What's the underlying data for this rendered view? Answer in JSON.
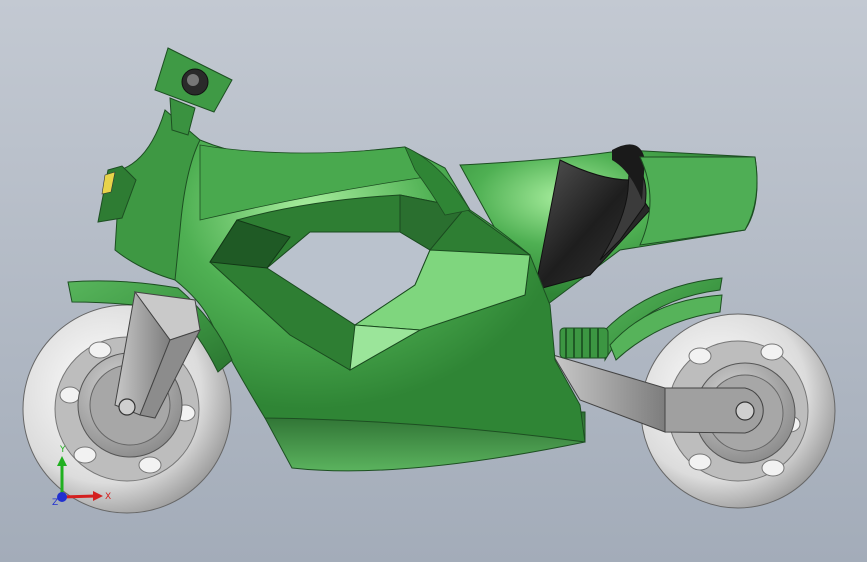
{
  "window": {
    "title": ""
  },
  "model": {
    "name": "",
    "parts": [
      {
        "id": "front-wheel",
        "icon": "wheel"
      },
      {
        "id": "rear-wheel",
        "icon": "wheel"
      },
      {
        "id": "body-fairing",
        "icon": "fairing"
      },
      {
        "id": "seat",
        "icon": "seat"
      },
      {
        "id": "mirror",
        "icon": "mirror"
      },
      {
        "id": "front-fork",
        "icon": "fork"
      },
      {
        "id": "swing-arm",
        "icon": "swingarm"
      },
      {
        "id": "rear-spring",
        "icon": "spring"
      }
    ],
    "colors": {
      "body": "#3f9a45",
      "body_dark": "#1f5a25",
      "body_light": "#8fdf8e",
      "seat": "#2a2a2a",
      "metal": "#a8a8a8",
      "tire": "#e6e6e6",
      "background_top": "#c0c6cf",
      "background_bottom": "#a6afbb"
    }
  },
  "triad": {
    "x_label": "X",
    "y_label": "Y",
    "z_label": "Z",
    "x_color": "#d42020",
    "y_color": "#20b020",
    "z_color": "#2030d0"
  }
}
